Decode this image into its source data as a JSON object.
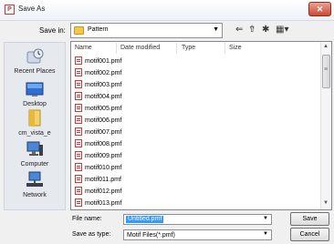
{
  "window": {
    "title": "Save As",
    "title_icon": "pattern-app-icon",
    "close_label": "✕"
  },
  "toolbar": {
    "save_in_label": "Save in:",
    "save_in_value": "Pattern",
    "folder_icon": "folder-icon",
    "back_glyph": "⇐",
    "up_glyph": "⇮",
    "new_folder_glyph": "✱",
    "view_glyph": "▦▾"
  },
  "places": [
    {
      "label": "Recent Places",
      "icon": "recent-places-icon"
    },
    {
      "label": "Desktop",
      "icon": "desktop-icon"
    },
    {
      "label": "cm_vista_e",
      "icon": "user-folder-icon"
    },
    {
      "label": "Computer",
      "icon": "computer-icon"
    },
    {
      "label": "Network",
      "icon": "network-icon"
    }
  ],
  "filelist": {
    "columns": [
      "Name",
      "Date modified",
      "Type",
      "Size"
    ],
    "files": [
      "motif001.pmf",
      "motif002.pmf",
      "motif003.pmf",
      "motif004.pmf",
      "motif005.pmf",
      "motif006.pmf",
      "motif007.pmf",
      "motif008.pmf",
      "motif009.pmf",
      "motif010.pmf",
      "motif011.pmf",
      "motif012.pmf",
      "motif013.pmf"
    ]
  },
  "form": {
    "file_name_label": "File name:",
    "file_name_value": "Untitled.pmf",
    "save_type_label": "Save as type:",
    "save_type_value": "Motif Files(*.pmf)"
  },
  "buttons": {
    "save": "Save",
    "cancel": "Cancel"
  },
  "colors": {
    "selection": "#3399ff",
    "folder": "#f3c84b",
    "close_button": "#c94a34"
  }
}
